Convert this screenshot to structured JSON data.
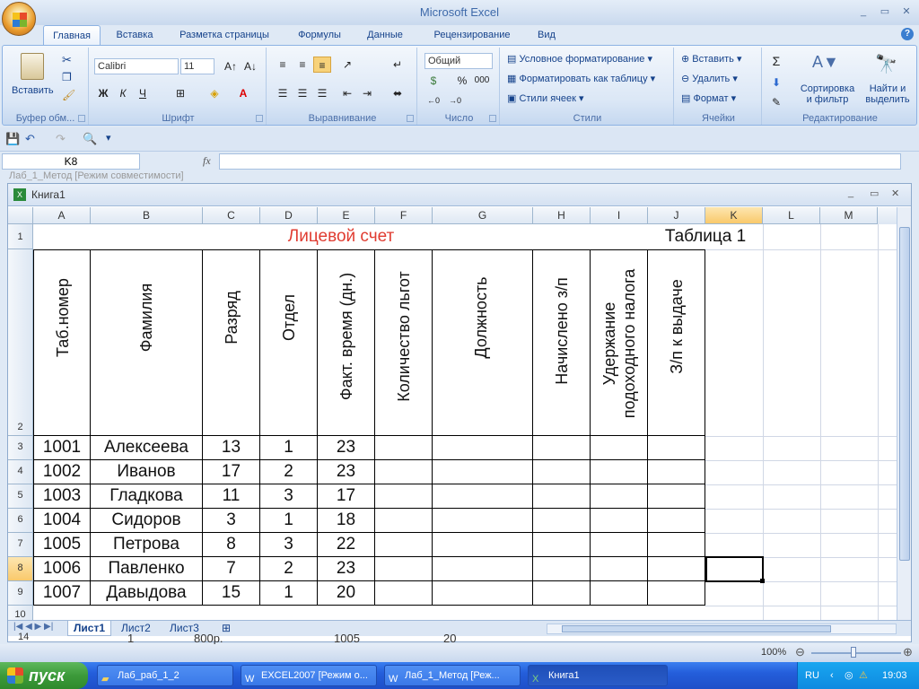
{
  "window": {
    "title": "Microsoft Excel",
    "minimize": "_",
    "maximize": "▭",
    "close": "✕"
  },
  "tabs": [
    {
      "label": "Главная"
    },
    {
      "label": "Вставка"
    },
    {
      "label": "Разметка страницы"
    },
    {
      "label": "Формулы"
    },
    {
      "label": "Данные"
    },
    {
      "label": "Рецензирование"
    },
    {
      "label": "Вид"
    }
  ],
  "ribbon": {
    "clipboard": {
      "label": "Буфер обм...",
      "paste": "Вставить"
    },
    "font": {
      "label": "Шрифт",
      "family": "Calibri",
      "size": "11",
      "bold": "Ж",
      "italic": "К",
      "underline": "Ч"
    },
    "alignment": {
      "label": "Выравнивание"
    },
    "number": {
      "label": "Число",
      "format": "Общий",
      "percent": "%",
      "thousands": "000"
    },
    "styles": {
      "label": "Стили",
      "conditional": "Условное форматирование",
      "as_table": "Форматировать как таблицу",
      "cell_styles": "Стили ячеек"
    },
    "cells": {
      "label": "Ячейки",
      "insert": "Вставить",
      "delete": "Удалить",
      "format": "Формат"
    },
    "editing": {
      "label": "Редактирование",
      "sort1": "Сортировка",
      "sort2": "и фильтр",
      "find1": "Найти и",
      "find2": "выделить"
    }
  },
  "namebox": "K8",
  "behind_title": "Лаб_1_Метод  [Режим совместимости]",
  "book": {
    "title": "Книга1"
  },
  "columns": [
    "A",
    "B",
    "C",
    "D",
    "E",
    "F",
    "G",
    "H",
    "I",
    "J",
    "K",
    "L",
    "M"
  ],
  "rows": [
    "1",
    "2",
    "3",
    "4",
    "5",
    "6",
    "7",
    "8",
    "9",
    "10"
  ],
  "sheet": {
    "title": "Лицевой счет",
    "title_color": "#e03c31",
    "table_label": "Таблица 1",
    "headers": [
      "Таб.номер",
      "Фамилия",
      "Разряд",
      "Отдел",
      "Факт. время (дн.)",
      "Количество льгот",
      "Должность",
      "Начислено з/п",
      "Удержание подоходного налога",
      "З/п к выдаче"
    ],
    "data": [
      [
        "1001",
        "Алексеева",
        "13",
        "1",
        "23"
      ],
      [
        "1002",
        "Иванов",
        "17",
        "2",
        "23"
      ],
      [
        "1003",
        "Гладкова",
        "11",
        "3",
        "17"
      ],
      [
        "1004",
        "Сидоров",
        "3",
        "1",
        "18"
      ],
      [
        "1005",
        "Петрова",
        "8",
        "3",
        "22"
      ],
      [
        "1006",
        "Павленко",
        "7",
        "2",
        "23"
      ],
      [
        "1007",
        "Давыдова",
        "15",
        "1",
        "20"
      ]
    ]
  },
  "sheet_tabs": [
    "Лист1",
    "Лист2",
    "Лист3"
  ],
  "behind_rows": {
    "row": "14",
    "v1": "1",
    "v2": "800р.",
    "v3": "1005",
    "v4": "20"
  },
  "zoom": "100%",
  "taskbar": {
    "start": "пуск",
    "tasks": [
      "Лаб_раб_1_2",
      "EXCEL2007 [Режим о...",
      "Лаб_1_Метод  [Реж...",
      "Книга1"
    ],
    "lang": "RU",
    "time": "19:03"
  }
}
